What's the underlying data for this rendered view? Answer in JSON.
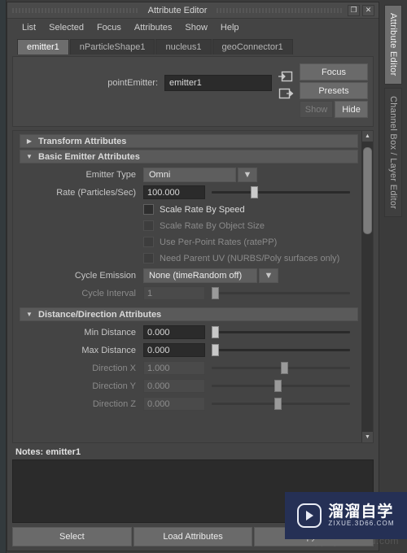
{
  "window": {
    "title": "Attribute Editor",
    "restore_glyph": "❐",
    "close_glyph": "✕"
  },
  "menu": {
    "items": [
      {
        "label": "List"
      },
      {
        "label": "Selected"
      },
      {
        "label": "Focus"
      },
      {
        "label": "Attributes"
      },
      {
        "label": "Show"
      },
      {
        "label": "Help"
      }
    ]
  },
  "node_tabs": [
    {
      "label": "emitter1",
      "active": true
    },
    {
      "label": "nParticleShape1",
      "active": false
    },
    {
      "label": "nucleus1",
      "active": false
    },
    {
      "label": "geoConnector1",
      "active": false
    }
  ],
  "header": {
    "node_type_label": "pointEmitter:",
    "node_name_value": "emitter1",
    "focus_label": "Focus",
    "presets_label": "Presets",
    "show_label": "Show",
    "hide_label": "Hide",
    "input_connection_icon": "node-input-icon",
    "output_connection_icon": "node-output-icon"
  },
  "sections": [
    {
      "title": "Transform Attributes",
      "expanded": false,
      "arrow": "▶"
    },
    {
      "title": "Basic Emitter Attributes",
      "expanded": true,
      "arrow": "▼",
      "rows": [
        {
          "kind": "combo",
          "label": "Emitter Type",
          "value": "Omni",
          "arrow": "▼",
          "enabled": true
        },
        {
          "kind": "field-slider",
          "label": "Rate (Particles/Sec)",
          "value": "100.000",
          "slider_pct": 28,
          "enabled": true
        },
        {
          "kind": "checkbox",
          "label": "Scale Rate By Speed",
          "checked": false,
          "enabled": true
        },
        {
          "kind": "checkbox",
          "label": "Scale Rate By Object Size",
          "checked": false,
          "enabled": false
        },
        {
          "kind": "checkbox",
          "label": "Use Per-Point Rates (ratePP)",
          "checked": false,
          "enabled": false
        },
        {
          "kind": "checkbox",
          "label": "Need Parent UV (NURBS/Poly surfaces only)",
          "checked": false,
          "enabled": false
        },
        {
          "kind": "combo",
          "label": "Cycle Emission",
          "value": "None (timeRandom off)",
          "arrow": "▼",
          "enabled": true
        },
        {
          "kind": "field-slider",
          "label": "Cycle Interval",
          "value": "1",
          "slider_pct": 0,
          "enabled": false
        }
      ]
    },
    {
      "title": "Distance/Direction Attributes",
      "expanded": true,
      "arrow": "▼",
      "rows": [
        {
          "kind": "field-slider",
          "label": "Min Distance",
          "value": "0.000",
          "slider_pct": 0,
          "enabled": true
        },
        {
          "kind": "field-slider",
          "label": "Max Distance",
          "value": "0.000",
          "slider_pct": 0,
          "enabled": true
        },
        {
          "kind": "field-slider",
          "label": "Direction X",
          "value": "1.000",
          "slider_pct": 50,
          "enabled": false
        },
        {
          "kind": "field-slider",
          "label": "Direction Y",
          "value": "0.000",
          "slider_pct": 45,
          "enabled": false
        },
        {
          "kind": "field-slider",
          "label": "Direction Z",
          "value": "0.000",
          "slider_pct": 45,
          "enabled": false
        }
      ]
    }
  ],
  "scrollbar": {
    "up_arrow": "▲",
    "down_arrow": "▼",
    "thumb_top_pct": 2,
    "thumb_height_pct": 30
  },
  "notes": {
    "label": "Notes:  emitter1",
    "value": ""
  },
  "footer": {
    "buttons": [
      {
        "label": "Select"
      },
      {
        "label": "Load Attributes"
      },
      {
        "label": "Copy Tab"
      }
    ]
  },
  "side_tabs": [
    {
      "label": "Attribute Editor",
      "active": true
    },
    {
      "label": "Channel Box / Layer Editor",
      "active": false
    }
  ],
  "watermark": {
    "cn_text": "溜溜自学",
    "en_text": "ZIXUE.3D66.COM",
    "ghost_text": "copyright.baidu.com",
    "bg_color": "#253055"
  },
  "colors": {
    "window_bg": "#444444",
    "panel_bg": "#484848",
    "field_bg": "#2b2b2b",
    "button_bg": "#6a6a6a",
    "section_header_bg": "#5a5a5a",
    "active_tab_bg": "#6d6d6d",
    "text": "#c8c8c8",
    "text_disabled": "#8a8a8a"
  }
}
